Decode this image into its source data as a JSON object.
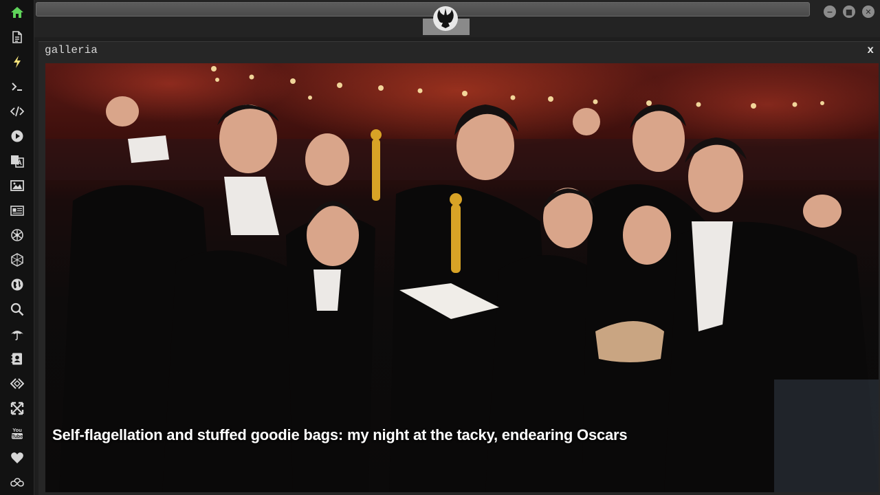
{
  "window": {
    "title": "galleria",
    "close_label": "x",
    "controls": {
      "minimize": "−",
      "maximize": "■",
      "close": "✕"
    }
  },
  "sidebar": {
    "items": [
      {
        "icon": "home-icon",
        "active": true
      },
      {
        "icon": "document-icon"
      },
      {
        "icon": "lightning-icon"
      },
      {
        "icon": "terminal-icon"
      },
      {
        "icon": "code-icon"
      },
      {
        "icon": "play-icon"
      },
      {
        "icon": "translate-icon"
      },
      {
        "icon": "image-icon"
      },
      {
        "icon": "newspaper-icon"
      },
      {
        "icon": "rebel-alliance-icon"
      },
      {
        "icon": "hexagon-icon"
      },
      {
        "icon": "globe-icon"
      },
      {
        "icon": "search-icon"
      },
      {
        "icon": "umbrella-icon"
      },
      {
        "icon": "contact-icon"
      },
      {
        "icon": "code-diamond-icon"
      },
      {
        "icon": "expand-icon"
      },
      {
        "icon": "youtube-icon"
      },
      {
        "icon": "heart-icon"
      },
      {
        "icon": "infinity-cloud-icon"
      }
    ]
  },
  "gallery": {
    "caption": "Self-flagellation and stuffed goodie bags: my night at the tacky, endearing Oscars"
  },
  "colors": {
    "active_icon": "#5fd35a",
    "icon": "#d6d6d6",
    "accent_light": "#f4e27a"
  }
}
